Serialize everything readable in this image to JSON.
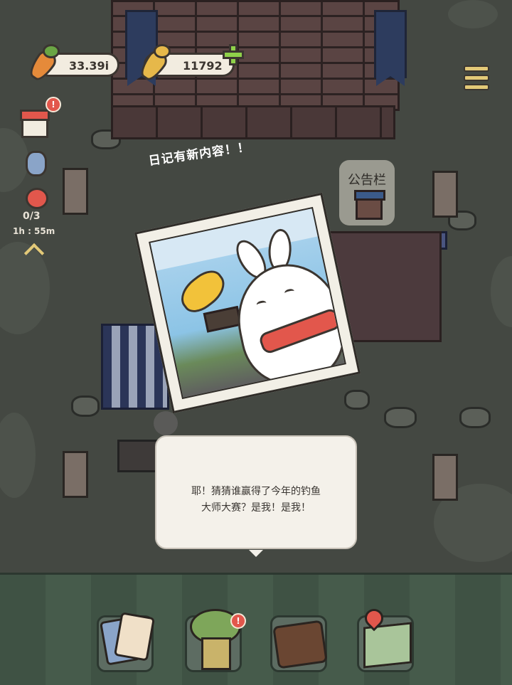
{
  "hud": {
    "carrots": "33.39i",
    "gold_carrots": "11792",
    "market_timer_progress": "0/3",
    "market_timer_time": "1h : 55m"
  },
  "scene": {
    "diary_notice": "日记有新内容！！",
    "bulletin_board_label": "公告栏"
  },
  "photo": {
    "subject": "bunny holding fishing trophy"
  },
  "dialog": {
    "line1": "耶！猜猜谁赢得了今年的钓鱼",
    "line2": "大师大赛？是我！是我！"
  },
  "bottom_nav": [
    {
      "name": "cards",
      "icon": "cards-icon"
    },
    {
      "name": "tree-house",
      "icon": "tree-house-icon"
    },
    {
      "name": "backpack",
      "icon": "backpack-icon"
    },
    {
      "name": "map",
      "icon": "map-icon"
    }
  ],
  "colors": {
    "alert": "#e2574c",
    "plus": "#8fd14a",
    "carrot": "#e58a3a",
    "gold_carrot": "#e6b84a"
  }
}
